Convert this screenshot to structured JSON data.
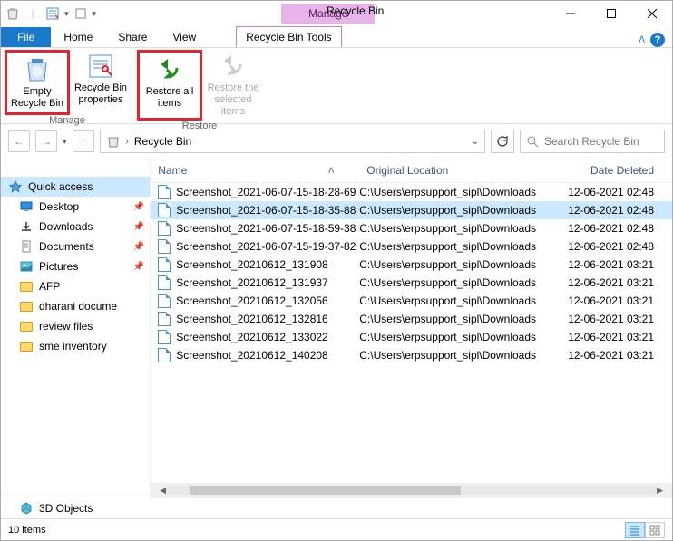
{
  "window": {
    "title": "Recycle Bin",
    "context_tab": "Manage",
    "context_tools": "Recycle Bin Tools"
  },
  "tabs": {
    "file": "File",
    "home": "Home",
    "share": "Share",
    "view": "View"
  },
  "ribbon": {
    "empty": "Empty Recycle Bin",
    "properties": "Recycle Bin properties",
    "restore_all": "Restore all items",
    "restore_sel": "Restore the selected items",
    "group_manage": "Manage",
    "group_restore": "Restore"
  },
  "address": {
    "location": "Recycle Bin"
  },
  "search": {
    "placeholder": "Search Recycle Bin"
  },
  "nav": {
    "quick_access": "Quick access",
    "desktop": "Desktop",
    "downloads": "Downloads",
    "documents": "Documents",
    "pictures": "Pictures",
    "afp": "AFP",
    "dharani": "dharani docume",
    "review": "review files",
    "sme": "sme inventory",
    "objects3d": "3D Objects"
  },
  "columns": {
    "name": "Name",
    "location": "Original Location",
    "date": "Date Deleted"
  },
  "rows": [
    {
      "name": "Screenshot_2021-06-07-15-18-28-69",
      "loc": "C:\\Users\\erpsupport_sipl\\Downloads",
      "date": "12-06-2021 02:48",
      "sel": false
    },
    {
      "name": "Screenshot_2021-06-07-15-18-35-88",
      "loc": "C:\\Users\\erpsupport_sipl\\Downloads",
      "date": "12-06-2021 02:48",
      "sel": true
    },
    {
      "name": "Screenshot_2021-06-07-15-18-59-38",
      "loc": "C:\\Users\\erpsupport_sipl\\Downloads",
      "date": "12-06-2021 02:48",
      "sel": false
    },
    {
      "name": "Screenshot_2021-06-07-15-19-37-82",
      "loc": "C:\\Users\\erpsupport_sipl\\Downloads",
      "date": "12-06-2021 02:48",
      "sel": false
    },
    {
      "name": "Screenshot_20210612_131908",
      "loc": "C:\\Users\\erpsupport_sipl\\Downloads",
      "date": "12-06-2021 03:21",
      "sel": false
    },
    {
      "name": "Screenshot_20210612_131937",
      "loc": "C:\\Users\\erpsupport_sipl\\Downloads",
      "date": "12-06-2021 03:21",
      "sel": false
    },
    {
      "name": "Screenshot_20210612_132056",
      "loc": "C:\\Users\\erpsupport_sipl\\Downloads",
      "date": "12-06-2021 03:21",
      "sel": false
    },
    {
      "name": "Screenshot_20210612_132816",
      "loc": "C:\\Users\\erpsupport_sipl\\Downloads",
      "date": "12-06-2021 03:21",
      "sel": false
    },
    {
      "name": "Screenshot_20210612_133022",
      "loc": "C:\\Users\\erpsupport_sipl\\Downloads",
      "date": "12-06-2021 03:21",
      "sel": false
    },
    {
      "name": "Screenshot_20210612_140208",
      "loc": "C:\\Users\\erpsupport_sipl\\Downloads",
      "date": "12-06-2021 03:21",
      "sel": false
    }
  ],
  "status": {
    "count": "10 items"
  }
}
